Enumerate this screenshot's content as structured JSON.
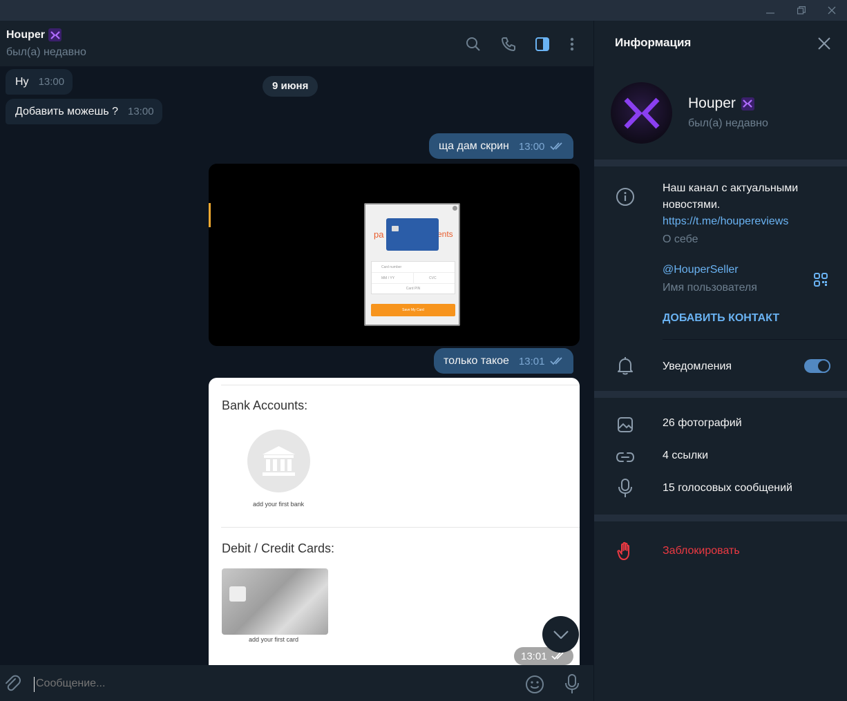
{
  "chat": {
    "name": "Houper",
    "status": "был(а) недавно",
    "date_label": "9 июня",
    "messages": [
      {
        "text": "Ну",
        "time": "13:00"
      },
      {
        "text": "Добавить можешь ?",
        "time": "13:00"
      },
      {
        "text": "ща дам скрин",
        "time": "13:00"
      },
      {
        "text": "только такое",
        "time": "13:01"
      }
    ],
    "image_time": "13:01",
    "composer_placeholder": "Сообщение..."
  },
  "screenshot_card": {
    "logo_left": "pa",
    "logo_right": "ents",
    "card_number": "Card number",
    "expiry": "MM / YY",
    "cvc": "CVC",
    "pin": "Card PIN",
    "save_button": "Save My Card"
  },
  "screenshot_bank": {
    "bank_title": "Bank Accounts:",
    "bank_caption": "add your first bank",
    "cards_title": "Debit / Credit Cards:",
    "card_caption": "add your first card"
  },
  "info_panel": {
    "title": "Информация",
    "name": "Houper",
    "status": "был(а) недавно",
    "bio_line1": "Наш канал с актуальными",
    "bio_line2": "новостями.",
    "bio_link": "https://t.me/houpereviews",
    "bio_label": "О себе",
    "username": "@HouperSeller",
    "username_label": "Имя пользователя",
    "add_contact": "ДОБАВИТЬ КОНТАКТ",
    "notifications": "Уведомления",
    "notifications_on": true,
    "photos": "26 фотографий",
    "links": "4 ссылки",
    "voice": "15 голосовых сообщений",
    "block": "Заблокировать"
  },
  "colors": {
    "accent": "#6ab3f3",
    "outgoing": "#2b5278",
    "incoming": "#182533",
    "danger": "#ec3942",
    "toggle": "#5288c1"
  }
}
